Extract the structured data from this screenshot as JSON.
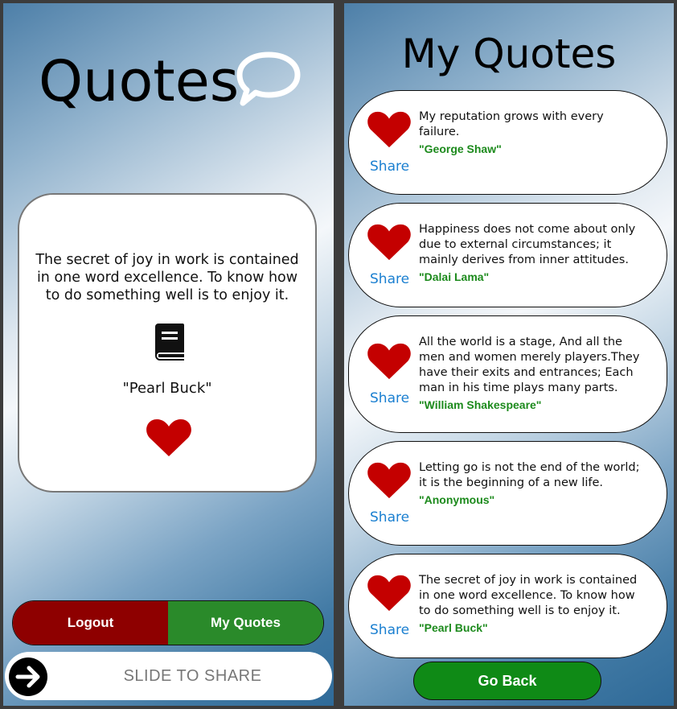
{
  "home": {
    "title": "Quotes",
    "featured": {
      "text": "The secret of joy in work is contained in one word excellence. To know how to do something well is to enjoy it.",
      "author": "\"Pearl Buck\""
    },
    "buttons": {
      "logout": "Logout",
      "my_quotes": "My Quotes"
    },
    "slider_label": "SLIDE TO SHARE"
  },
  "my_quotes": {
    "title": "My Quotes",
    "share_label": "Share",
    "items": [
      {
        "text": "My reputation grows with every failure.",
        "author": "\"George Shaw\""
      },
      {
        "text": "Happiness does not come about only due to external circumstances; it mainly derives from inner attitudes.",
        "author": "\"Dalai Lama\""
      },
      {
        "text": "All the world is a stage, And all the men and women merely players.They have their exits and entrances; Each man in his time plays many parts.",
        "author": "\"William Shakespeare\""
      },
      {
        "text": "Letting go is not the end of the world; it is the beginning of a new life.",
        "author": "\"Anonymous\""
      },
      {
        "text": "The secret of joy in work is contained in one word excellence. To know how to do something well is to enjoy it.",
        "author": "\"Pearl Buck\""
      }
    ],
    "go_back": "Go Back"
  },
  "colors": {
    "heart": "#c40000",
    "logout": "#8e0000",
    "my_quotes": "#2a8a2a",
    "go_back": "#0f8a16",
    "share_link": "#1a7fd0",
    "author": "#1c8a1c"
  },
  "icons": [
    "speech-bubble-icon",
    "book-icon",
    "heart-icon",
    "arrow-right-icon"
  ]
}
